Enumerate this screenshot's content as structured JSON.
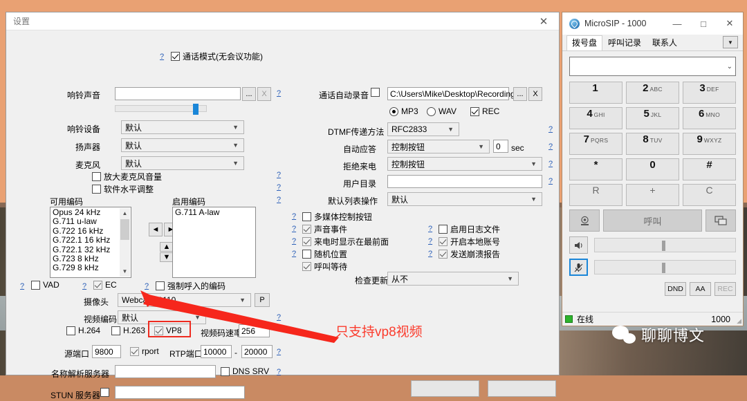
{
  "settings": {
    "title": "设置",
    "close_icon": "close-icon",
    "call_mode": {
      "label": "通话模式(无会议功能)",
      "checked": true,
      "help": "?"
    },
    "ring_sound": {
      "label": "响铃声音",
      "value": "",
      "browse": "...",
      "clear": "X",
      "help": "?",
      "volume_percent": 90
    },
    "ring_device": {
      "label": "响铃设备",
      "value": "默认"
    },
    "speaker": {
      "label": "扬声器",
      "value": "默认"
    },
    "microphone": {
      "label": "麦克风",
      "value": "默认"
    },
    "boost_mic": {
      "label": "放大麦克风音量",
      "checked": false,
      "help": "?"
    },
    "sw_level": {
      "label": "软件水平调整",
      "checked": false,
      "help": "?"
    },
    "codecs": {
      "available_label": "可用编码",
      "enabled_label": "启用编码",
      "help": "?",
      "available": [
        "Opus 24 kHz",
        "G.711 u-law",
        "G.722 16 kHz",
        "G.722.1 16 kHz",
        "G.722.1 32 kHz",
        "G.723 8 kHz",
        "G.729 8 kHz"
      ],
      "enabled": [
        "G.711 A-law"
      ],
      "move_left": "◄",
      "move_right": "►",
      "move_up": "▲",
      "move_down": "▼"
    },
    "vad": {
      "label": "VAD",
      "checked": false,
      "help": "?"
    },
    "ec": {
      "label": "EC",
      "checked": true,
      "help": "?"
    },
    "force_codec": {
      "label": "强制呼入的编码",
      "checked": false,
      "help": "?"
    },
    "camera": {
      "label": "摄像头",
      "value": "Webcam C110",
      "prop_btn": "P"
    },
    "video_codec": {
      "label": "视频编码",
      "value": "默认",
      "help": "?"
    },
    "h264": {
      "label": "H.264",
      "checked": false
    },
    "h263": {
      "label": "H.263",
      "checked": false
    },
    "vp8": {
      "label": "VP8",
      "checked": true
    },
    "bitrate": {
      "label": "视频码速率",
      "value": "256"
    },
    "source_port": {
      "label": "源端口",
      "value": "9800"
    },
    "rport": {
      "label": "rport",
      "checked": true
    },
    "rtp_port": {
      "label": "RTP端口",
      "from": "10000",
      "dash": "-",
      "to": "20000",
      "help": "?"
    },
    "dns_server": {
      "label": "名称解析服务器",
      "value": ""
    },
    "dns_srv": {
      "label": "DNS SRV",
      "checked": false,
      "help": "?"
    },
    "stun": {
      "label": "STUN 服务器",
      "checked": false,
      "value": ""
    },
    "auto_record": {
      "label": "通话自动录音",
      "checked": false,
      "path": "C:\\Users\\Mike\\Desktop\\Recordings",
      "browse": "...",
      "clear": "X"
    },
    "format": {
      "mp3": "MP3",
      "wav": "WAV",
      "selected": "MP3",
      "rec": {
        "label": "REC",
        "checked": true
      }
    },
    "dtmf": {
      "label": "DTMF传递方法",
      "value": "RFC2833",
      "help": "?"
    },
    "auto_answer": {
      "label": "自动应答",
      "value": "控制按钮",
      "seconds": "0",
      "unit": "sec",
      "help": "?"
    },
    "reject_call": {
      "label": "拒绝来电",
      "value": "控制按钮",
      "help": "?"
    },
    "user_dir": {
      "label": "用户目录",
      "value": "",
      "help": "?"
    },
    "default_list_action": {
      "label": "默认列表操作",
      "value": "默认"
    },
    "multimedia_buttons": {
      "label": "多媒体控制按钮",
      "checked": false,
      "help": "?"
    },
    "sound_events": {
      "label": "声音事件",
      "checked": true,
      "help": "?"
    },
    "front_on_call": {
      "label": "来电时显示在最前面",
      "checked": true,
      "help": "?"
    },
    "random_position": {
      "label": "随机位置",
      "checked": false,
      "help": "?"
    },
    "call_waiting": {
      "label": "呼叫等待",
      "checked": true
    },
    "enable_log": {
      "label": "启用日志文件",
      "checked": false,
      "help": "?"
    },
    "local_account": {
      "label": "开启本地账号",
      "checked": true,
      "help": "?"
    },
    "crash_report": {
      "label": "发送崩溃报告",
      "checked": true,
      "help": "?"
    },
    "check_update": {
      "label": "检查更新",
      "value": "从不"
    }
  },
  "annotation": {
    "text": "只支持vp8视频",
    "color": "#fb3b2c"
  },
  "microsip": {
    "title": "MicroSIP - 1000",
    "app_icon": "phone-globe-icon",
    "window_buttons": {
      "minimize": "—",
      "maximize": "□",
      "close": "✕"
    },
    "tabs": [
      {
        "label": "拨号盘",
        "active": true
      },
      {
        "label": "呼叫记录",
        "active": false
      },
      {
        "label": "联系人",
        "active": false
      }
    ],
    "tab_menu_icon": "chevron-down-icon",
    "dial_input": {
      "value": "",
      "dropdown_icon": "chevron-down-icon"
    },
    "keypad": [
      {
        "digit": "1",
        "letters": ""
      },
      {
        "digit": "2",
        "letters": "ABC"
      },
      {
        "digit": "3",
        "letters": "DEF"
      },
      {
        "digit": "4",
        "letters": "GHI"
      },
      {
        "digit": "5",
        "letters": "JKL"
      },
      {
        "digit": "6",
        "letters": "MNO"
      },
      {
        "digit": "7",
        "letters": "PQRS"
      },
      {
        "digit": "8",
        "letters": "TUV"
      },
      {
        "digit": "9",
        "letters": "WXYZ"
      },
      {
        "digit": "*",
        "letters": ""
      },
      {
        "digit": "0",
        "letters": ""
      },
      {
        "digit": "#",
        "letters": ""
      },
      {
        "digit": "R",
        "letters": ""
      },
      {
        "digit": "+",
        "letters": ""
      },
      {
        "digit": "C",
        "letters": ""
      }
    ],
    "actions": {
      "video_icon": "webcam-icon",
      "call_label": "呼叫",
      "message_icon": "message-icon"
    },
    "speaker": {
      "icon": "speaker-icon",
      "value_percent": 48
    },
    "mic": {
      "icon": "microphone-muted-icon",
      "value_percent": 48,
      "selected": true
    },
    "toggles": [
      {
        "label": "DND",
        "active": true
      },
      {
        "label": "AA",
        "active": true
      },
      {
        "label": "REC",
        "active": false
      }
    ],
    "status": {
      "icon": "online-icon",
      "text": "在线",
      "account": "1000"
    }
  },
  "watermark": {
    "text": "聊聊博文",
    "icon": "wechat-icon"
  }
}
